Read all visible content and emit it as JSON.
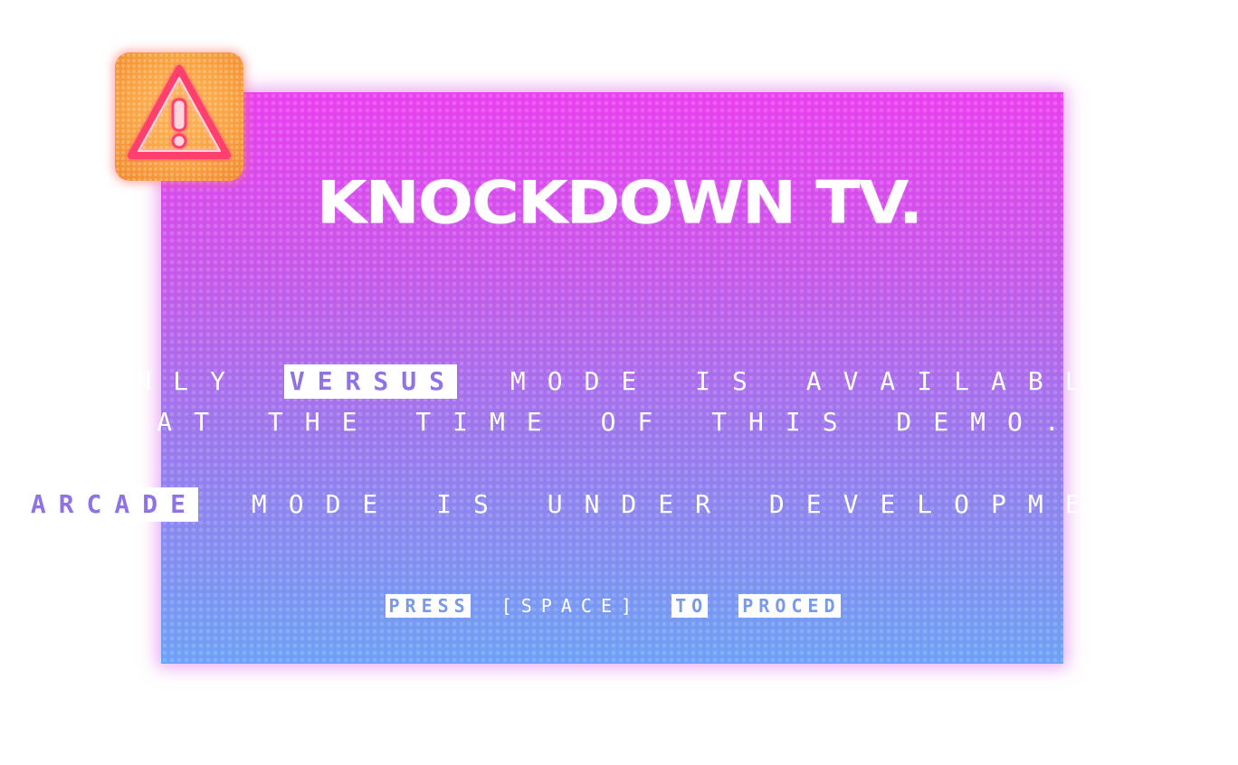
{
  "title": "KNOCKDOWN TV.",
  "warning_icon": "warning-triangle-icon",
  "message": {
    "line1_prefix": "ONLY",
    "line1_highlight": "VERSUS",
    "line1_suffix": "MODE IS AVAILABLE",
    "line2": "AT THE TIME OF THIS DEMO.",
    "line3_highlight": "ARCADE",
    "line3_suffix": "MODE IS UNDER DEVELOPMENT."
  },
  "prompt": {
    "press": "PRESS",
    "key": "[SPACE]",
    "to": "TO",
    "proceed": "PROCED"
  },
  "colors": {
    "panel_top": "#ea3ff0",
    "panel_bottom": "#6da2f4",
    "badge": "#f9a242",
    "icon_stroke": "#ff3f6e"
  }
}
